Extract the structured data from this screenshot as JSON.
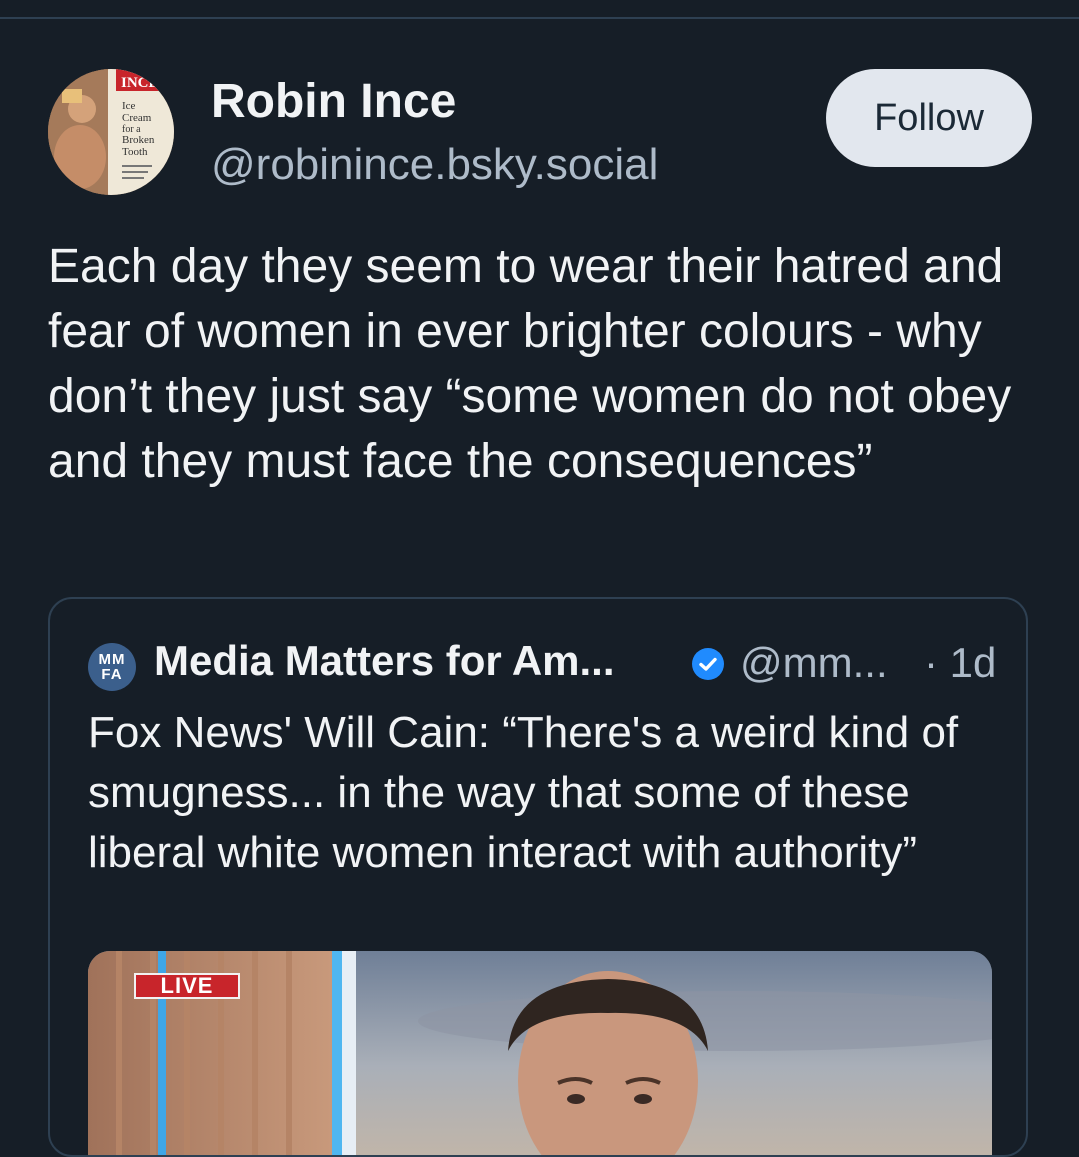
{
  "post": {
    "author_name": "Robin Ince",
    "author_handle": "@robinince.bsky.social",
    "follow_label": "Follow",
    "avatar_text": [
      "INCE",
      "Ice",
      "Cream",
      "for a",
      "Broken",
      "Tooth"
    ],
    "text": "Each day they seem to wear their hatred and fear of women in ever brighter colours - why don’t they just say “some women do not obey and they must face the consequences”"
  },
  "quote": {
    "avatar_text_top": "MM",
    "avatar_text_bottom": "FA",
    "author_name": "Media Matters for Am...",
    "author_handle": "@mm...",
    "time": "· 1d",
    "text": "Fox News' Will Cain: “There's a weird kind of smugness... in the way that some of these liberal white women interact with authority”",
    "media_badge": "LIVE"
  },
  "colors": {
    "background": "#161e27",
    "divider": "#2e4052",
    "verified": "#208bfe",
    "follow_bg": "#e2e7ee"
  }
}
